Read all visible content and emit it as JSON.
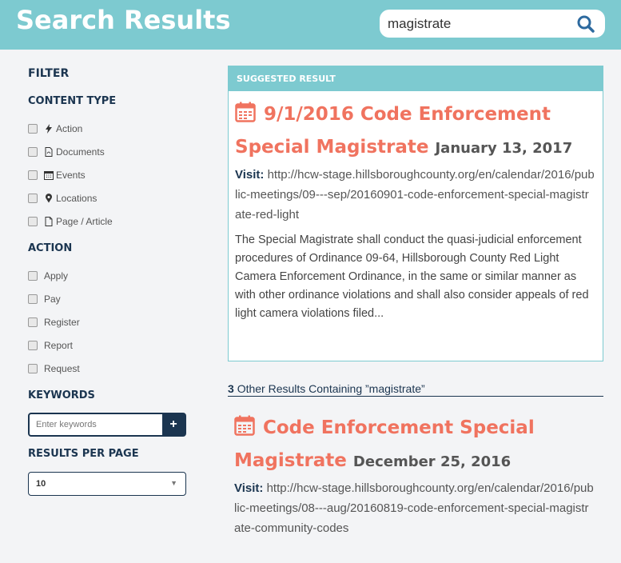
{
  "header": {
    "title": "Search Results",
    "search_value": "magistrate"
  },
  "sidebar": {
    "filter_title": "FILTER",
    "content_type_title": "CONTENT TYPE",
    "content_types": [
      {
        "label": "Action",
        "icon": "bolt-icon"
      },
      {
        "label": "Documents",
        "icon": "pdf-file-icon"
      },
      {
        "label": "Events",
        "icon": "calendar-icon"
      },
      {
        "label": "Locations",
        "icon": "map-pin-icon"
      },
      {
        "label": "Page / Article",
        "icon": "page-icon"
      }
    ],
    "action_title": "ACTION",
    "actions": [
      "Apply",
      "Pay",
      "Register",
      "Report",
      "Request"
    ],
    "keywords_title": "KEYWORDS",
    "keywords_placeholder": "Enter keywords",
    "keywords_add": "+",
    "results_per_page_title": "RESULTS PER PAGE",
    "results_per_page_value": "10"
  },
  "suggested": {
    "header": "SUGGESTED RESULT",
    "title_part1": "9/1/2016 Code Enforcement",
    "title_part2": "Special Magistrate",
    "date": "January 13, 2017",
    "visit_label": "Visit:",
    "url": "http://hcw-stage.hillsboroughcounty.org/en/calendar/2016/public-meetings/09---sep/20160901-code-enforcement-special-magistrate-red-light",
    "description": "The Special Magistrate shall conduct the quasi-judicial enforcement procedures of Ordinance 09-64, Hillsborough County Red Light Camera Enforcement Ordinance, in the same or similar manner as with other ordinance violations and shall also consider appeals of red light camera violations filed..."
  },
  "other": {
    "count": "3",
    "text": "Other Results Containing ”magistrate”"
  },
  "results": [
    {
      "title_part1": "Code Enforcement Special",
      "title_part2": "Magistrate",
      "date": "December 25, 2016",
      "visit_label": "Visit:",
      "url": "http://hcw-stage.hillsboroughcounty.org/en/calendar/2016/public-meetings/08---aug/20160819-code-enforcement-special-magistrate-community-codes"
    }
  ],
  "colors": {
    "header_bg": "#7dcad0",
    "title_accent": "#f0735f",
    "navy": "#1b3550"
  }
}
